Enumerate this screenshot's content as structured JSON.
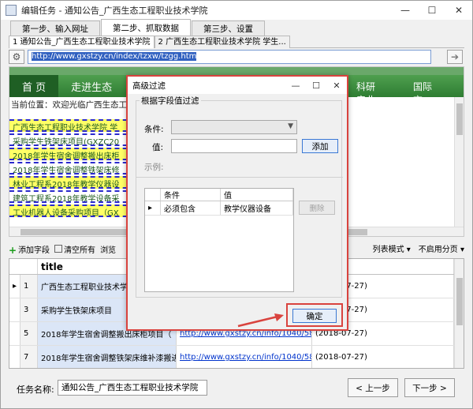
{
  "window": {
    "title": "编辑任务 - 通知公告_广西生态工程职业技术学院"
  },
  "steps": [
    {
      "label": "第一步、输入网址"
    },
    {
      "label": "第二步、抓取数据"
    },
    {
      "label": "第三步、设置"
    }
  ],
  "subtabs": [
    {
      "label": "1 通知公告_广西生态工程职业技术学院"
    },
    {
      "label": "2 广西生态工程职业技术学院 学生..."
    }
  ],
  "url": "http://www.gxstzy.cn/index/tzxw/tzgg.htm",
  "browser": {
    "nav": [
      "首 页",
      "走进生态"
    ],
    "nav_right": [
      "科研产业",
      "国际交"
    ],
    "breadcrumb": "当前位置：欢迎光临广西生态工程职",
    "list": [
      "广西生态工程职业技术学院 学",
      "采购学生铁架床项目(GXZC20",
      "2018年学生宿舍调整搬出床柜",
      "2018年学生宿舍调整铁架床修",
      "林业工程系2018年教学仪器设",
      "建筑工程系2018年教学设备采",
      "工业机器人设备采购项目（GX"
    ]
  },
  "toolbar": {
    "add_field": "添加字段",
    "clear_all": "清空所有",
    "browse": "浏览",
    "list_mode": "列表模式 ▾",
    "paging": "不启用分页 ▾"
  },
  "grid": {
    "header_title": "title",
    "rows": [
      {
        "idx": "1",
        "title": "广西生态工程职业技术学院",
        "link": "",
        "date": "(2018-07-27)"
      },
      {
        "idx": "3",
        "title": "采购学生铁架床项目",
        "link": "",
        "date": "(2018-07-27)"
      },
      {
        "idx": "5",
        "title": "2018年学生宿舍调整搬出床柜项目（",
        "link": "http://www.gxstzy.cn/info/1040/5838.htm",
        "date": "(2018-07-27)"
      },
      {
        "idx": "7",
        "title": "2018年学生宿舍调整铁架床维补漆搬进",
        "link": "http://www.gxstzy.cn/info/1040/5837.htm",
        "date": "(2018-07-27)"
      }
    ]
  },
  "footer": {
    "task_label": "任务名称:",
    "task_value": "通知公告_广西生态工程职业技术学院",
    "prev": "< 上一步",
    "next": "下一步 >"
  },
  "dialog": {
    "title": "高级过滤",
    "group_label": "根据字段值过滤",
    "condition_label": "条件:",
    "value_label": "值:",
    "add": "添加",
    "example_label": "示例:",
    "table_headers": [
      "条件",
      "值"
    ],
    "table_rows": [
      {
        "cond": "必须包含",
        "val": "教学仪器设备"
      }
    ],
    "delete": "删除",
    "ok": "确定"
  },
  "colors": {
    "highlight": "#d9433e",
    "nav_green": "#2e7d32",
    "accent_blue": "#3a78d4"
  }
}
